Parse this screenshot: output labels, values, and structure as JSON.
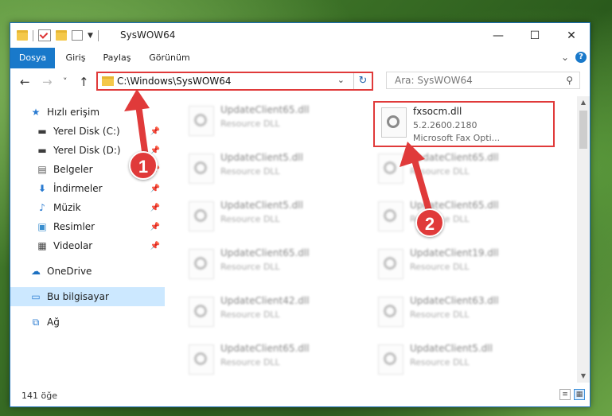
{
  "window": {
    "title": "SysWOW64",
    "controls": {
      "minimize": "—",
      "maximize": "☐",
      "close": "✕"
    }
  },
  "ribbon": {
    "tabs": [
      "Dosya",
      "Giriş",
      "Paylaş",
      "Görünüm"
    ],
    "expand_glyph": "⌄",
    "help": "?"
  },
  "navigation": {
    "back": "←",
    "forward": "→",
    "recent": "˅",
    "up": "↑",
    "address": "C:\\Windows\\SysWOW64",
    "address_dropdown": "⌄",
    "refresh": "↻",
    "search_placeholder": "Ara: SysWOW64",
    "search_icon": "⚲"
  },
  "sidebar": {
    "items": [
      {
        "label": "Hızlı erişim",
        "icon": "star-icon",
        "pinned": false
      },
      {
        "label": "Yerel Disk (C:)",
        "icon": "drive-icon",
        "pinned": true
      },
      {
        "label": "Yerel Disk (D:)",
        "icon": "drive-icon",
        "pinned": true
      },
      {
        "label": "Belgeler",
        "icon": "document-icon",
        "pinned": true
      },
      {
        "label": "İndirmeler",
        "icon": "download-icon",
        "pinned": true
      },
      {
        "label": "Müzik",
        "icon": "music-icon",
        "pinned": true
      },
      {
        "label": "Resimler",
        "icon": "pictures-icon",
        "pinned": true
      },
      {
        "label": "Videolar",
        "icon": "video-icon",
        "pinned": true
      },
      {
        "label": "OneDrive",
        "icon": "cloud-icon",
        "pinned": false
      },
      {
        "label": "Bu bilgisayar",
        "icon": "computer-icon",
        "pinned": false
      },
      {
        "label": "Ağ",
        "icon": "network-icon",
        "pinned": false
      }
    ],
    "pin_glyph": "📌"
  },
  "files": {
    "left_column": [
      {
        "name": "UpdateClient65.dll",
        "type": "Resource DLL"
      },
      {
        "name": "UpdateClient5.dll",
        "type": "Resource DLL"
      },
      {
        "name": "UpdateClient5.dll",
        "type": "Resource DLL"
      },
      {
        "name": "UpdateClient65.dll",
        "type": "Resource DLL"
      },
      {
        "name": "UpdateClient42.dll",
        "type": "Resource DLL"
      },
      {
        "name": "UpdateClient65.dll",
        "type": "Resource DLL"
      }
    ],
    "right_column": [
      {
        "name": "fxsocm.dll",
        "version": "5.2.2600.2180",
        "description": "Microsoft  Fax Opti..."
      },
      {
        "name": "UpdateClient65.dll",
        "type": "Resource DLL"
      },
      {
        "name": "UpdateClient65.dll",
        "type": "Resource DLL"
      },
      {
        "name": "UpdateClient19.dll",
        "type": "Resource DLL"
      },
      {
        "name": "UpdateClient63.dll",
        "type": "Resource DLL"
      },
      {
        "name": "UpdateClient5.dll",
        "type": "Resource DLL"
      }
    ]
  },
  "status": {
    "count": "141 öğe"
  },
  "annotations": {
    "step1": "1",
    "step2": "2",
    "color": "#e03a3a"
  }
}
